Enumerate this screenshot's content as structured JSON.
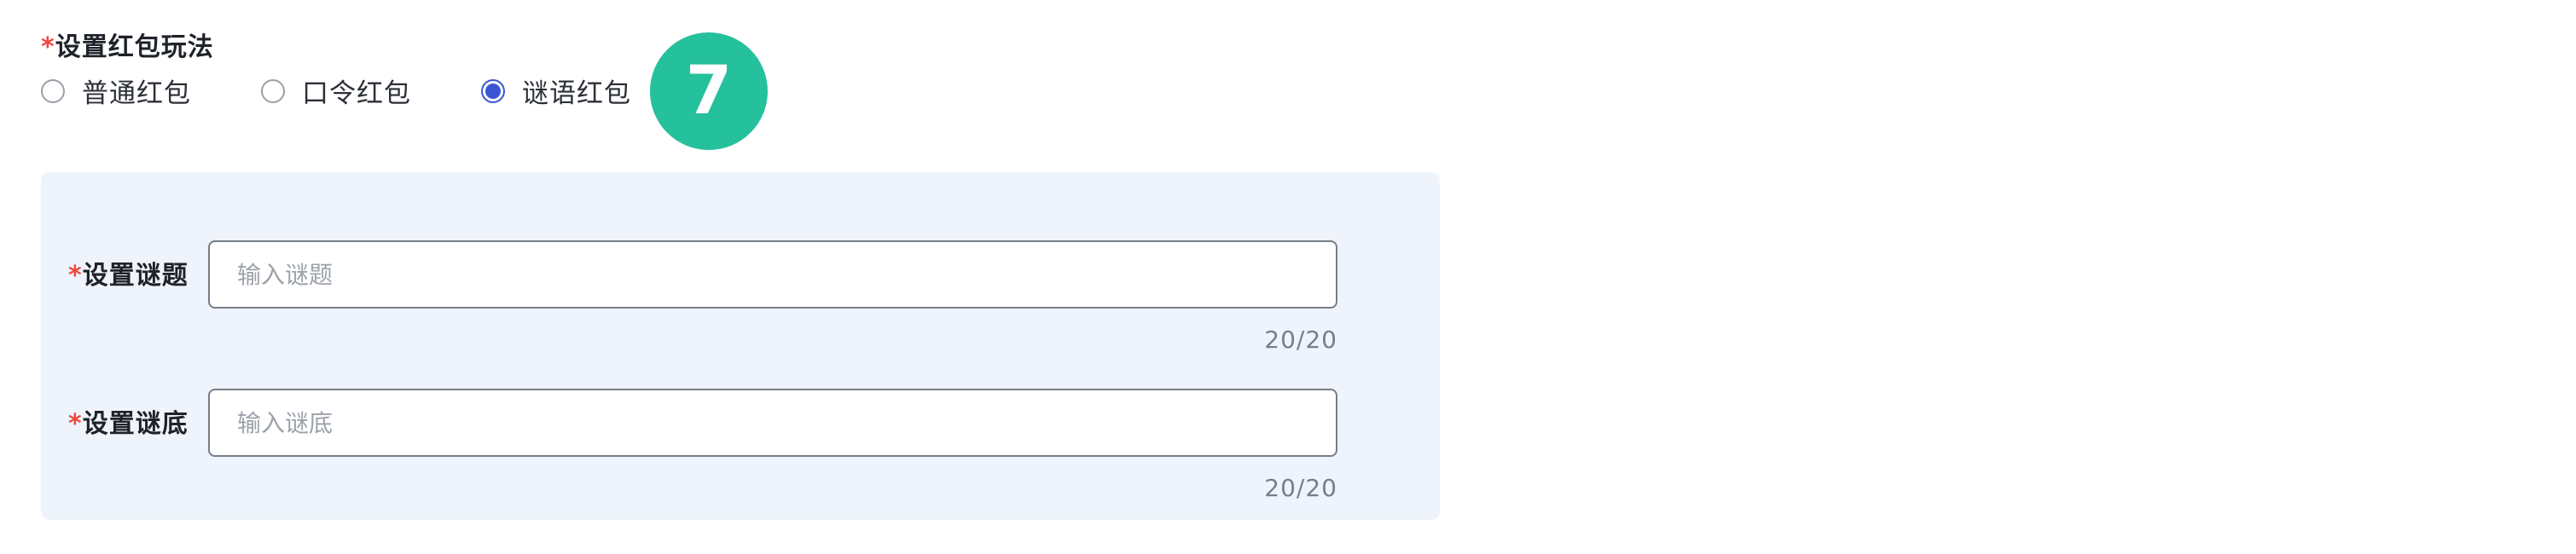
{
  "play_section": {
    "required_mark": "*",
    "title": "设置红包玩法",
    "options": [
      {
        "label": "普通红包",
        "selected": false
      },
      {
        "label": "口令红包",
        "selected": false
      },
      {
        "label": "谜语红包",
        "selected": true
      }
    ]
  },
  "step_badge": "7",
  "riddle_form": {
    "question": {
      "required_mark": "*",
      "label": "设置谜题",
      "placeholder": "输入谜题",
      "counter": "20/20"
    },
    "answer": {
      "required_mark": "*",
      "label": "设置谜底",
      "placeholder": "输入谜底",
      "counter": "20/20"
    }
  },
  "colors": {
    "accent": "#3a56d4",
    "required": "#f0483e",
    "badge": "#25c09c",
    "panel_bg": "#eff3fb"
  }
}
